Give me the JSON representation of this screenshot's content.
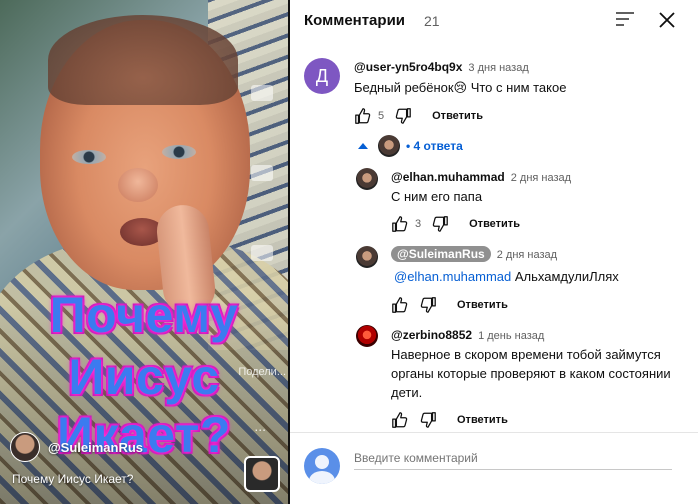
{
  "video": {
    "overlay_line1": "Почему",
    "overlay_line2": "Иисус",
    "overlay_line3": "Икает?",
    "share_label": "Подели...",
    "more_label": "...",
    "channel_name": "@SuleimanRus",
    "title": "Почему Иисус Икает?"
  },
  "panel": {
    "title": "Комментарии",
    "count": "21"
  },
  "comments": [
    {
      "avatar_letter": "Д",
      "author": "@user-yn5ro4bq9x",
      "time": "3 дня назад",
      "text": "Бедный ребёнок😢 Что с ним такое",
      "likes": "5",
      "reply_label": "Ответить",
      "replies_label": "4 ответа"
    }
  ],
  "replies": [
    {
      "author": "@elhan.muhammad",
      "time": "2 дня назад",
      "text": "С ним его папа",
      "likes": "3",
      "reply_label": "Ответить"
    },
    {
      "author": "@SuleimanRus",
      "time": "2 дня назад",
      "mention": "@elhan.muhammad",
      "text": " АльхамдулиЛлях",
      "reply_label": "Ответить"
    },
    {
      "author": "@zerbino8852",
      "time": "1 день назад",
      "text_lines": [
        "Наверное в скором времени тобой займутся",
        "органы которые проверяют в каком состоянии",
        "дети."
      ],
      "reply_label": "Ответить"
    }
  ],
  "compose": {
    "placeholder": "Введите комментарий"
  },
  "colors": {
    "link": "#065fd4",
    "avatar_purple": "#7e57c2",
    "overlay_blue": "#3b7bf0",
    "overlay_magenta": "#ff2fd6"
  }
}
